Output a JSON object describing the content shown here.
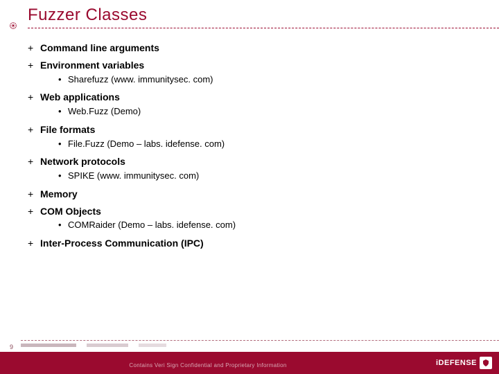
{
  "title": "Fuzzer Classes",
  "page_number": "9",
  "footer_text": "Contains Veri Sign Confidential and Proprietary Information",
  "logo_text": "iDEFENSE",
  "items": [
    {
      "label": "Command line arguments",
      "sub": null
    },
    {
      "label": "Environment variables",
      "sub": "Sharefuzz (www. immunitysec. com)"
    },
    {
      "label": "Web applications",
      "sub": "Web.Fuzz (Demo)"
    },
    {
      "label": "File formats",
      "sub": "File.Fuzz (Demo – labs. idefense. com)"
    },
    {
      "label": "Network protocols",
      "sub": "SPIKE (www. immunitysec. com)"
    },
    {
      "label": "Memory",
      "sub": null
    },
    {
      "label": "COM Objects",
      "sub": "COMRaider (Demo – labs. idefense. com)"
    },
    {
      "label": "Inter-Process Communication (IPC)",
      "sub": null
    }
  ]
}
